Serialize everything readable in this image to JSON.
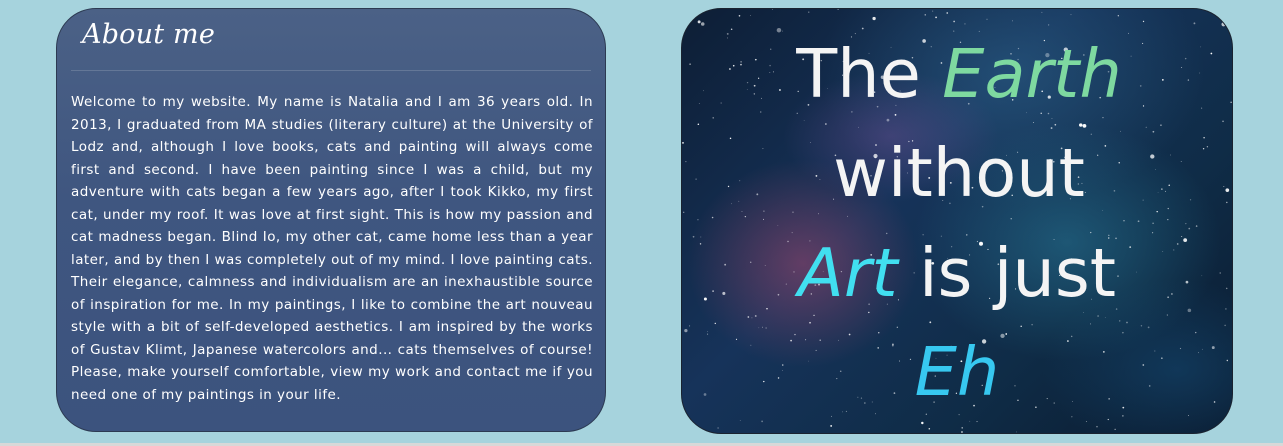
{
  "about": {
    "title": "About me",
    "body": "Welcome to my website. My name is Natalia and I am 36 years old. In 2013, I graduated from MA studies (literary culture) at the University of Lodz and, although I love books, cats and painting will always come first and second. I have been painting since I was a child, but my adventure with cats began a few years ago, after I took Kikko, my first cat, under my roof. It was love at first sight. This is how my passion and cat madness began. Blind Io, my other cat, came home less than a year later, and by then I was completely out of my mind. I love painting cats. Their elegance, calmness and individualism are an inexhaustible source of inspiration for me. In my paintings, I like to combine the art nouveau style with a bit of self-developed aesthetics. I am inspired by the works of Gustav Klimt, Japanese watercolors and... cats themselves of course! Please, make yourself comfortable, view my work and contact me if you need one of my paintings in your life."
  },
  "artwork": {
    "line1_plain": "The ",
    "line1_accent": "Earth",
    "line2": "without",
    "line3_accent": "Art",
    "line3_plain": " is just",
    "line4_accent": "Eh"
  },
  "colors": {
    "page_background": "#a6d3dd",
    "card_background": "#44597f",
    "earth_accent": "#7ed9a0",
    "art_accent": "#41dff0",
    "eh_accent": "#37c8f0"
  }
}
